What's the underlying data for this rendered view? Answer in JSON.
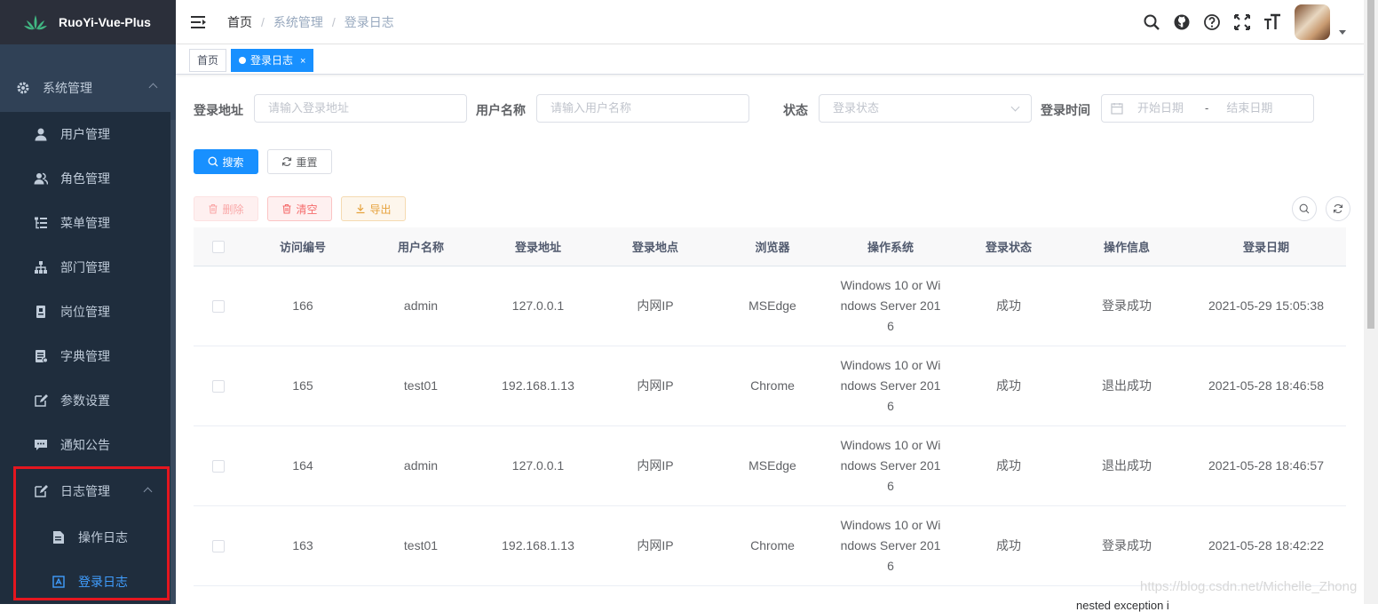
{
  "sidebar": {
    "app_title": "RuoYi-Vue-Plus",
    "root_menu": "系统管理",
    "items": [
      {
        "label": "用户管理",
        "icon": "user-icon"
      },
      {
        "label": "角色管理",
        "icon": "peoples-icon"
      },
      {
        "label": "菜单管理",
        "icon": "tree-table-icon"
      },
      {
        "label": "部门管理",
        "icon": "tree-icon"
      },
      {
        "label": "岗位管理",
        "icon": "post-icon"
      },
      {
        "label": "字典管理",
        "icon": "dict-icon"
      },
      {
        "label": "参数设置",
        "icon": "edit-icon"
      },
      {
        "label": "通知公告",
        "icon": "message-icon"
      }
    ],
    "log_group": {
      "label": "日志管理",
      "items": [
        {
          "label": "操作日志",
          "icon": "form-icon"
        },
        {
          "label": "登录日志",
          "icon": "logininfor-icon",
          "active": true
        }
      ]
    }
  },
  "navbar": {
    "breadcrumb": [
      "首页",
      "系统管理",
      "登录日志"
    ],
    "breadcrumb_sep": "/"
  },
  "tags": [
    {
      "label": "首页",
      "active": false
    },
    {
      "label": "登录日志",
      "active": true,
      "close": "×"
    }
  ],
  "filters": {
    "ipaddr_label": "登录地址",
    "ipaddr_placeholder": "请输入登录地址",
    "username_label": "用户名称",
    "username_placeholder": "请输入用户名称",
    "status_label": "状态",
    "status_placeholder": "登录状态",
    "time_label": "登录时间",
    "start_placeholder": "开始日期",
    "range_sep": "-",
    "end_placeholder": "结束日期"
  },
  "buttons": {
    "search": "搜索",
    "reset": "重置",
    "delete": "删除",
    "clean": "清空",
    "export": "导出"
  },
  "table": {
    "columns": [
      "访问编号",
      "用户名称",
      "登录地址",
      "登录地点",
      "浏览器",
      "操作系统",
      "登录状态",
      "操作信息",
      "登录日期"
    ],
    "rows": [
      {
        "id": "166",
        "user": "admin",
        "ip": "127.0.0.1",
        "loc": "内网IP",
        "browser": "MSEdge",
        "os": "Windows 10 or Windows Server 2016",
        "status": "成功",
        "msg": "登录成功",
        "date": "2021-05-29 15:05:38"
      },
      {
        "id": "165",
        "user": "test01",
        "ip": "192.168.1.13",
        "loc": "内网IP",
        "browser": "Chrome",
        "os": "Windows 10 or Windows Server 2016",
        "status": "成功",
        "msg": "退出成功",
        "date": "2021-05-28 18:46:58"
      },
      {
        "id": "164",
        "user": "admin",
        "ip": "127.0.0.1",
        "loc": "内网IP",
        "browser": "MSEdge",
        "os": "Windows 10 or Windows Server 2016",
        "status": "成功",
        "msg": "退出成功",
        "date": "2021-05-28 18:46:57"
      },
      {
        "id": "163",
        "user": "test01",
        "ip": "192.168.1.13",
        "loc": "内网IP",
        "browser": "Chrome",
        "os": "Windows 10 or Windows Server 2016",
        "status": "成功",
        "msg": "登录成功",
        "date": "2021-05-28 18:42:22"
      }
    ]
  },
  "watermark": "https://blog.csdn.net/Michelle_Zhong",
  "cut_text": "nested exception i",
  "colors": {
    "sidebar_bg": "#304156",
    "submenu_bg": "#1f2d3d",
    "primary": "#1890ff",
    "highlight_box": "#e4161f"
  }
}
